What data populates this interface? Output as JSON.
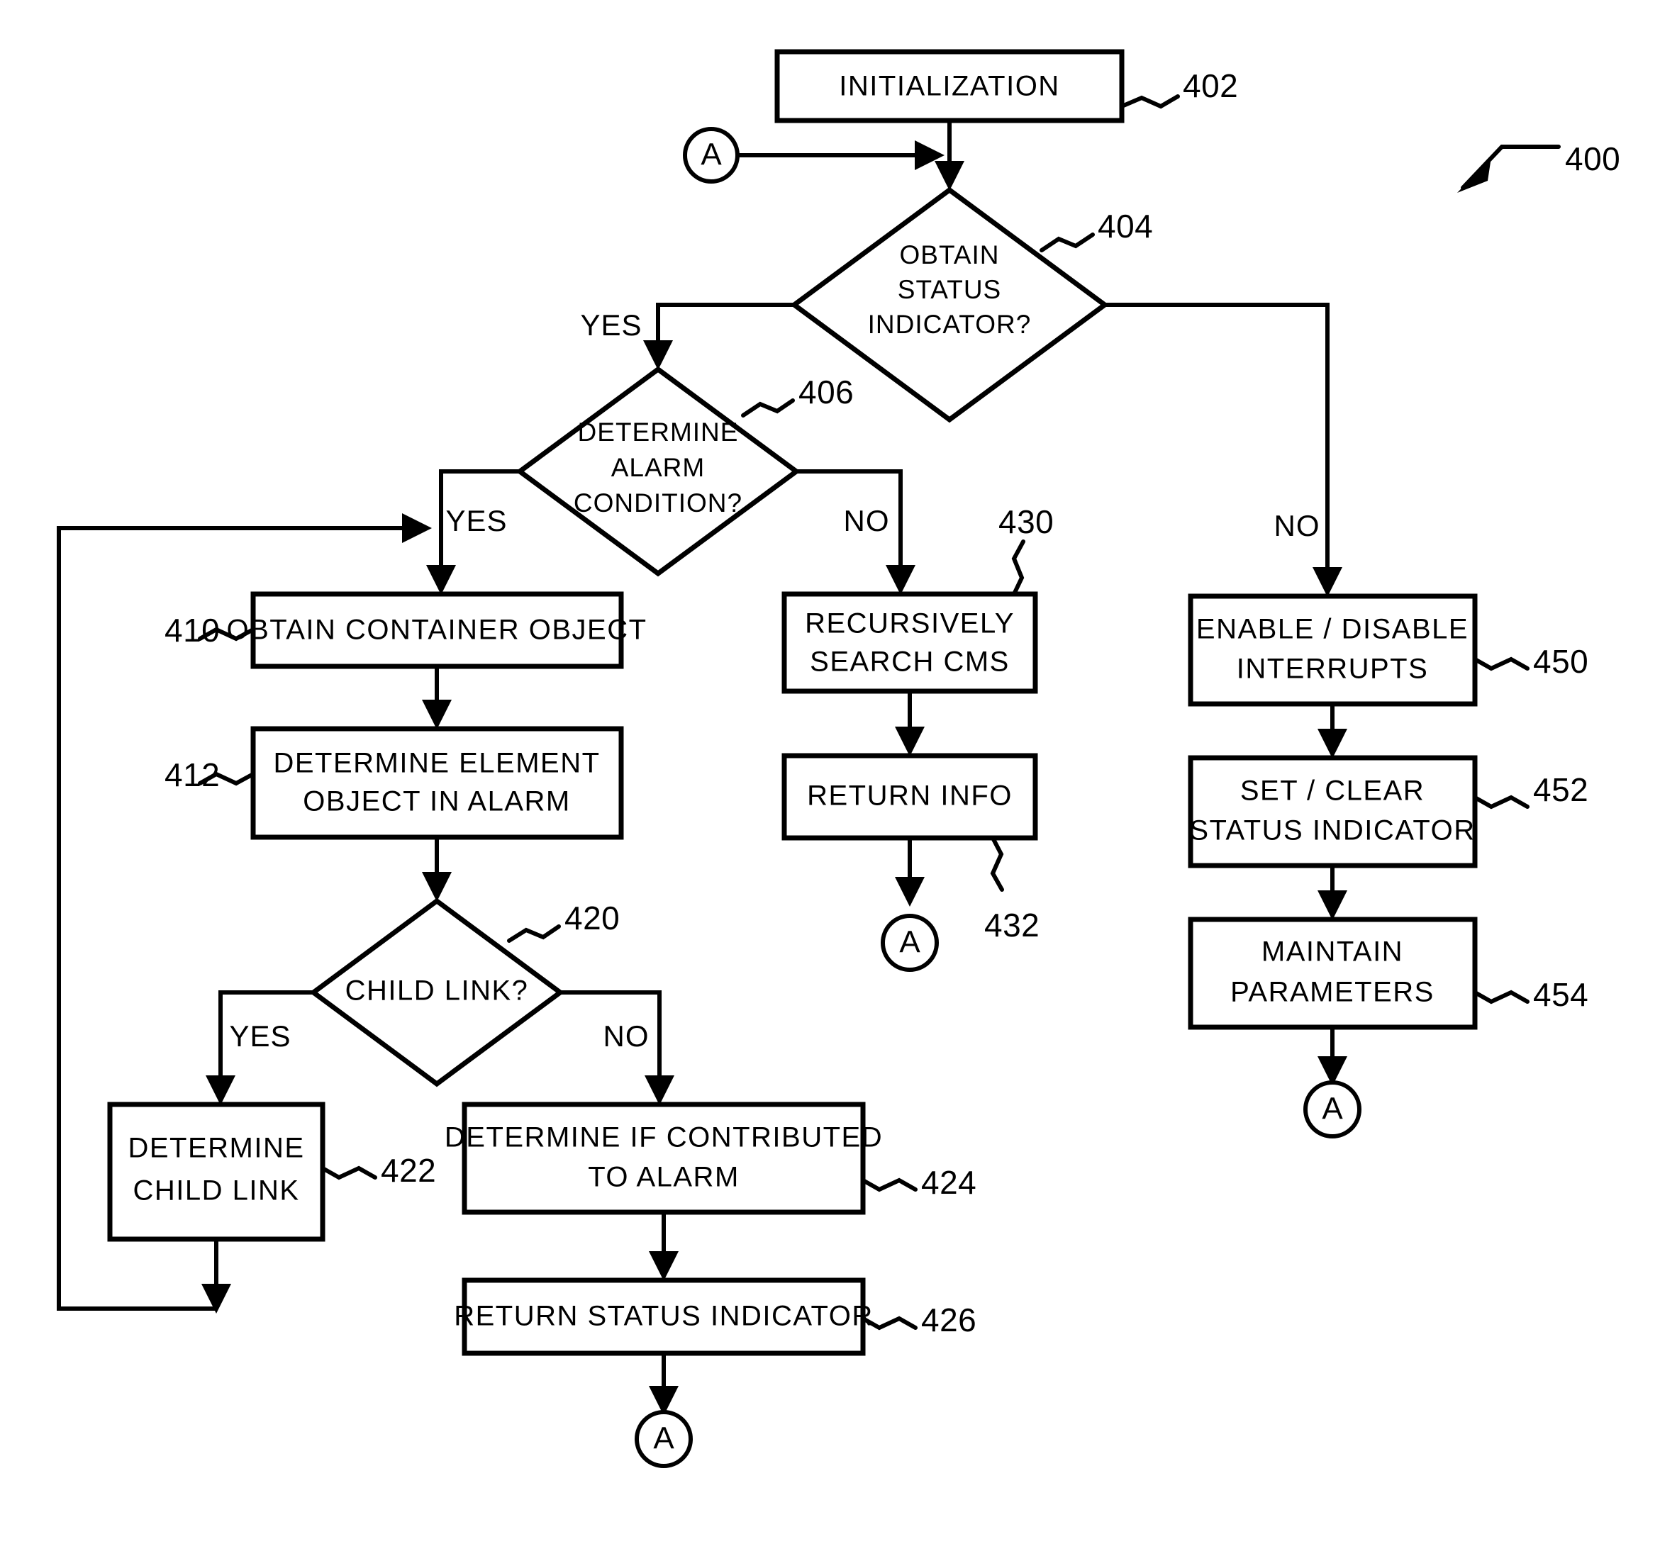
{
  "figure": {
    "reference_numeral": "400",
    "type": "flowchart"
  },
  "nodes": {
    "initialization": {
      "label": "INITIALIZATION",
      "ref": "402",
      "shape": "process"
    },
    "obtain_status": {
      "line1": "OBTAIN",
      "line2": "STATUS",
      "line3": "INDICATOR?",
      "ref": "404",
      "shape": "decision"
    },
    "determine_alarm": {
      "line1": "DETERMINE",
      "line2": "ALARM",
      "line3": "CONDITION?",
      "ref": "406",
      "shape": "decision"
    },
    "obtain_container": {
      "label": "OBTAIN CONTAINER OBJECT",
      "ref": "410",
      "shape": "process"
    },
    "determine_element": {
      "line1": "DETERMINE ELEMENT",
      "line2": "OBJECT IN ALARM",
      "ref": "412",
      "shape": "process"
    },
    "child_link": {
      "label": "CHILD LINK?",
      "ref": "420",
      "shape": "decision"
    },
    "determine_child_link": {
      "line1": "DETERMINE",
      "line2": "CHILD LINK",
      "ref": "422",
      "shape": "process"
    },
    "determine_contributed": {
      "line1": "DETERMINE IF CONTRIBUTED",
      "line2": "TO ALARM",
      "ref": "424",
      "shape": "process"
    },
    "return_status_indicator": {
      "label": "RETURN STATUS INDICATOR",
      "ref": "426",
      "shape": "process"
    },
    "recursively_search": {
      "line1": "RECURSIVELY",
      "line2": "SEARCH CMS",
      "ref": "430",
      "shape": "process"
    },
    "return_info": {
      "label": "RETURN INFO",
      "shape": "process"
    },
    "enable_disable": {
      "line1": "ENABLE / DISABLE",
      "line2": "INTERRUPTS",
      "ref": "450",
      "shape": "process"
    },
    "set_clear": {
      "line1": "SET / CLEAR",
      "line2": "STATUS INDICATOR",
      "ref": "452",
      "shape": "process"
    },
    "maintain_parameters": {
      "line1": "MAINTAIN",
      "line2": "PARAMETERS",
      "ref": "454",
      "shape": "process"
    }
  },
  "connectors": {
    "entry_a": {
      "letter": "A"
    },
    "exit_a_432": {
      "letter": "A",
      "ref": "432"
    },
    "exit_a_right": {
      "letter": "A"
    },
    "exit_a_bottom": {
      "letter": "A"
    }
  },
  "branch_labels": {
    "status_yes": "YES",
    "status_no": "NO",
    "alarm_yes": "YES",
    "alarm_no": "NO",
    "child_yes": "YES",
    "child_no": "NO"
  },
  "colors": {
    "stroke": "#000000",
    "fill": "#ffffff",
    "text": "#000000"
  }
}
